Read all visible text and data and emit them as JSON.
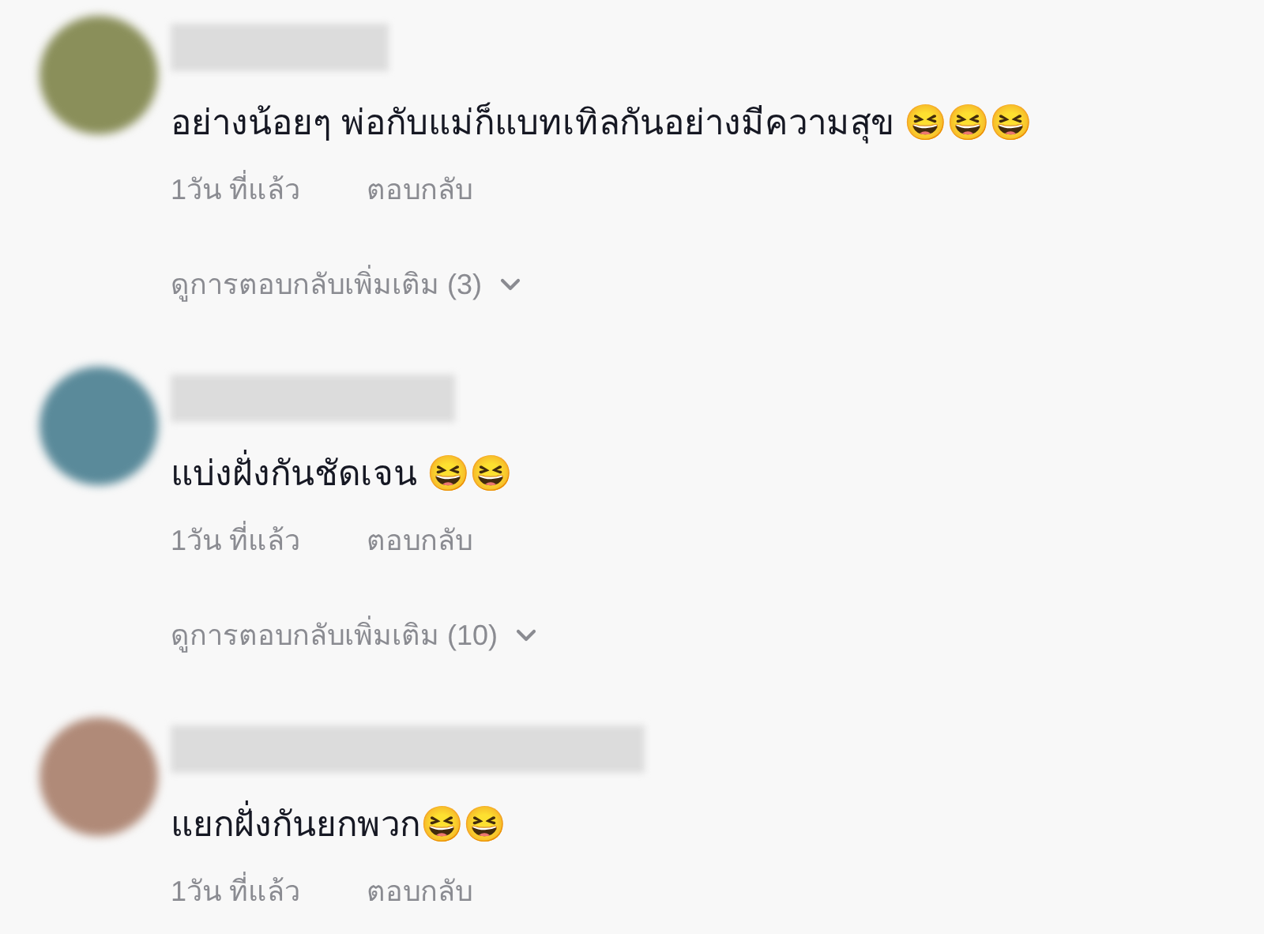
{
  "comments": [
    {
      "text": "อย่างน้อยๆ พ่อกับแม่ก็แบทเทิลกันอย่างมีความสุข 😆😆😆",
      "time": "1วัน ที่แล้ว",
      "reply": "ตอบกลับ",
      "more_replies": "ดูการตอบกลับเพิ่มเติม (3)"
    },
    {
      "text": "แบ่งฝั่งกันชัดเจน 😆😆",
      "time": "1วัน ที่แล้ว",
      "reply": "ตอบกลับ",
      "more_replies": "ดูการตอบกลับเพิ่มเติม (10)"
    },
    {
      "text": "แยกฝั่งกันยกพวก😆😆",
      "time": "1วัน ที่แล้ว",
      "reply": "ตอบกลับ"
    }
  ]
}
